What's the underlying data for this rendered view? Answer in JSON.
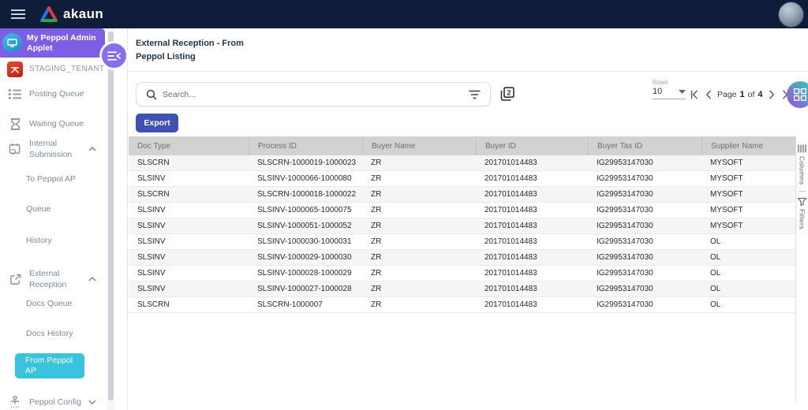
{
  "topbar": {
    "brand": "akaun"
  },
  "sidebar": {
    "applet_title": "My Peppol Admin Applet",
    "tenant": "STAGING_TENANT",
    "items": {
      "posting_queue": "Posting Queue",
      "waiting_queue": "Waiting Queue",
      "internal_submission": "Internal Submission",
      "to_peppol_ap": "To Peppol AP",
      "queue": "Queue",
      "history": "History",
      "external_reception": "External Reception",
      "docs_queue": "Docs Queue",
      "docs_history": "Docs History",
      "from_peppol_ap": "From Peppol AP",
      "peppol_config": "Peppol Config"
    }
  },
  "main": {
    "title": "External Reception - From Peppol Listing",
    "toolbar": {
      "search_placeholder": "Search...",
      "rows_label": "Rows",
      "rows_value": "10",
      "page_label": "Page",
      "page_current": "1",
      "page_of": "of",
      "page_total": "4"
    },
    "export_label": "Export",
    "table": {
      "columns": [
        "Doc Type",
        "Process ID",
        "Buyer Name",
        "Buyer ID",
        "Buyer Tax ID",
        "Supplier Name"
      ],
      "rows": [
        [
          "SLSCRN",
          "SLSCRN-1000019-1000023",
          "ZR",
          "201701014483",
          "IG29953147030",
          "MYSOFT"
        ],
        [
          "SLSINV",
          "SLSINV-1000066-1000080",
          "ZR",
          "201701014483",
          "IG29953147030",
          "MYSOFT"
        ],
        [
          "SLSCRN",
          "SLSCRN-1000018-1000022",
          "ZR",
          "201701014483",
          "IG29953147030",
          "MYSOFT"
        ],
        [
          "SLSINV",
          "SLSINV-1000065-1000075",
          "ZR",
          "201701014483",
          "IG29953147030",
          "MYSOFT"
        ],
        [
          "SLSINV",
          "SLSINV-1000051-1000052",
          "ZR",
          "201701014483",
          "IG29953147030",
          "MYSOFT"
        ],
        [
          "SLSINV",
          "SLSINV-1000030-1000031",
          "ZR",
          "201701014483",
          "IG29953147030",
          "OL"
        ],
        [
          "SLSINV",
          "SLSINV-1000029-1000030",
          "ZR",
          "201701014483",
          "IG29953147030",
          "OL"
        ],
        [
          "SLSINV",
          "SLSINV-1000028-1000029",
          "ZR",
          "201701014483",
          "IG29953147030",
          "OL"
        ],
        [
          "SLSINV",
          "SLSINV-1000027-1000028",
          "ZR",
          "201701014483",
          "IG29953147030",
          "OL"
        ],
        [
          "SLSCRN",
          "SLSCRN-1000007",
          "ZR",
          "201701014483",
          "IG29953147030",
          "OL"
        ]
      ]
    },
    "side_tools": {
      "columns": "Columns",
      "filters": "Filters"
    }
  },
  "colors": {
    "topbar_navy": "#0f1d3a",
    "applet_purple": "#7d5fe6",
    "selected_cyan": "#38c4dc",
    "export_indigo": "#3f51b2",
    "tenant_red": "#d8281c",
    "table_header_gray": "#d2d2d2"
  }
}
